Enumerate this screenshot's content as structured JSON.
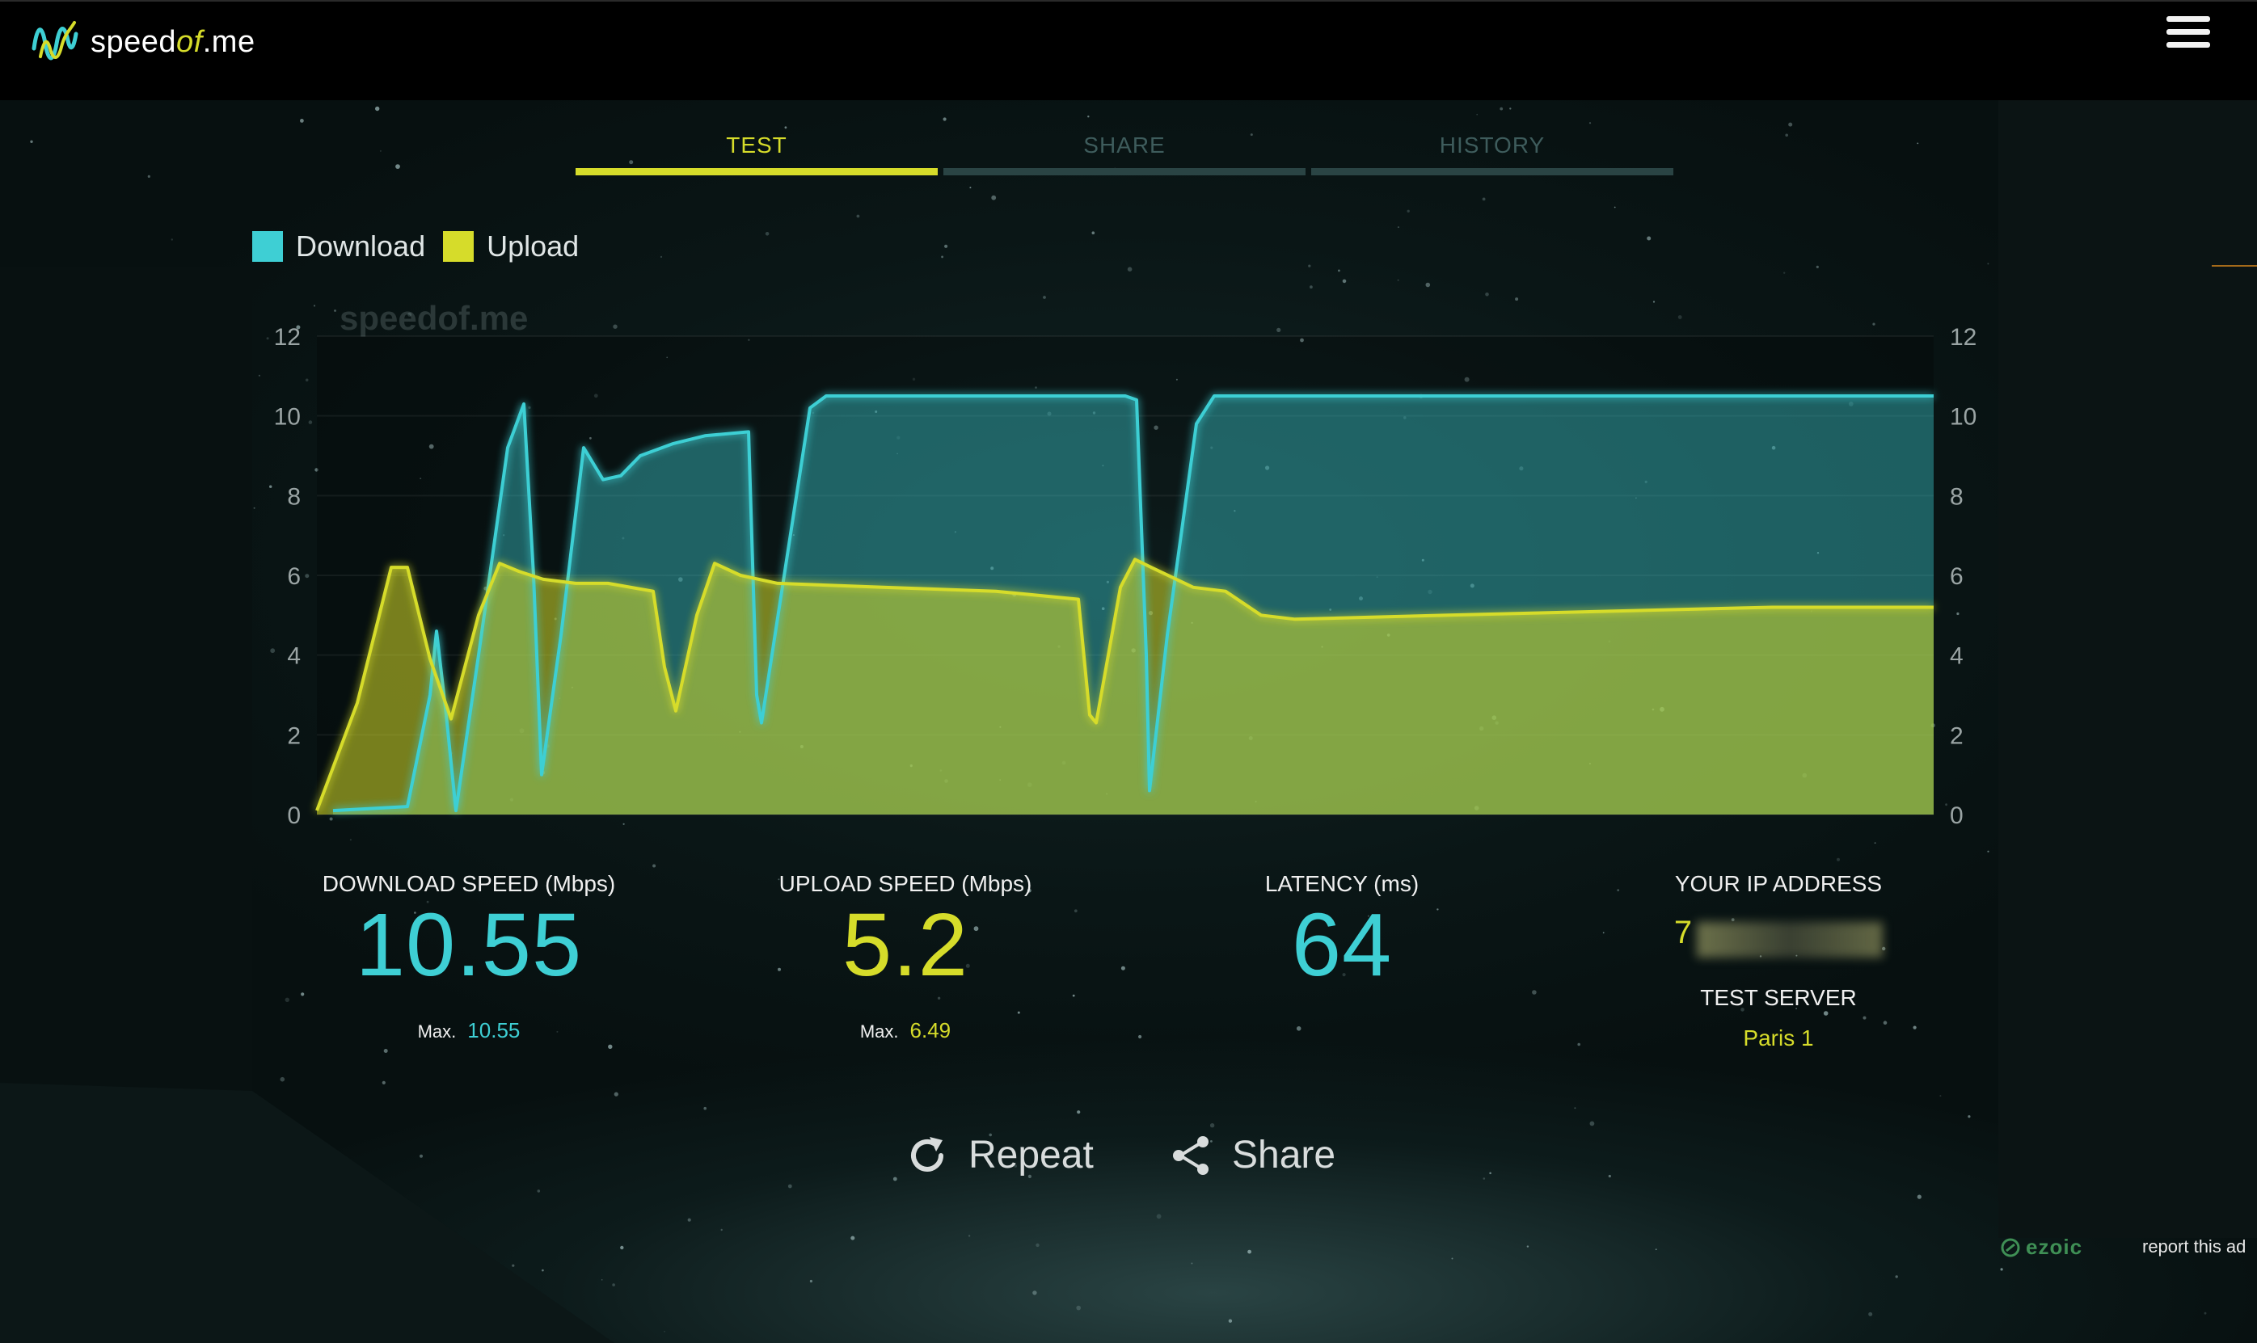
{
  "header": {
    "logo_pre": "speed",
    "logo_mid": "of",
    "logo_post": ".me"
  },
  "tabs": [
    {
      "label": "TEST",
      "active": true
    },
    {
      "label": "SHARE",
      "active": false
    },
    {
      "label": "HISTORY",
      "active": false
    }
  ],
  "colors": {
    "download": "#3ecfd4",
    "upload": "#d6dc2a",
    "header_bg": "#000000"
  },
  "chart_data": {
    "type": "area",
    "watermark": "speedof.me",
    "ylim": [
      0,
      12
    ],
    "yticks": [
      0,
      2,
      4,
      6,
      8,
      10,
      12
    ],
    "xlim": [
      0,
      100
    ],
    "grid": true,
    "legend": "top-left",
    "series": [
      {
        "name": "Download",
        "color": "#3ecfd4",
        "points": [
          [
            1,
            0.1
          ],
          [
            5.6,
            0.2
          ],
          [
            7,
            3
          ],
          [
            7.4,
            4.6
          ],
          [
            8,
            2.5
          ],
          [
            8.6,
            0.1
          ],
          [
            10,
            4
          ],
          [
            11.8,
            9.2
          ],
          [
            12.8,
            10.3
          ],
          [
            13.4,
            6
          ],
          [
            13.9,
            1
          ],
          [
            15.1,
            4.5
          ],
          [
            16.5,
            9.2
          ],
          [
            17.7,
            8.4
          ],
          [
            18.8,
            8.5
          ],
          [
            20,
            9
          ],
          [
            22,
            9.3
          ],
          [
            24,
            9.5
          ],
          [
            26.7,
            9.6
          ],
          [
            27.2,
            3
          ],
          [
            27.5,
            2.3
          ],
          [
            30.5,
            10.2
          ],
          [
            31.5,
            10.5
          ],
          [
            40,
            10.5
          ],
          [
            50,
            10.5
          ],
          [
            50.7,
            10.4
          ],
          [
            51.3,
            4
          ],
          [
            51.5,
            0.6
          ],
          [
            52.6,
            4.5
          ],
          [
            54.4,
            9.8
          ],
          [
            55.5,
            10.5
          ],
          [
            60,
            10.5
          ],
          [
            70,
            10.5
          ],
          [
            80,
            10.5
          ],
          [
            90,
            10.5
          ],
          [
            100,
            10.5
          ]
        ]
      },
      {
        "name": "Upload",
        "color": "#d6dc2a",
        "points": [
          [
            0,
            0.1
          ],
          [
            2.5,
            2.8
          ],
          [
            4.6,
            6.2
          ],
          [
            5.6,
            6.2
          ],
          [
            7,
            3.9
          ],
          [
            8.3,
            2.4
          ],
          [
            10,
            5
          ],
          [
            11.3,
            6.3
          ],
          [
            12.5,
            6.1
          ],
          [
            14,
            5.9
          ],
          [
            16,
            5.8
          ],
          [
            18,
            5.8
          ],
          [
            20.8,
            5.6
          ],
          [
            21.5,
            3.7
          ],
          [
            22.2,
            2.6
          ],
          [
            23.5,
            5
          ],
          [
            24.6,
            6.3
          ],
          [
            26.2,
            6
          ],
          [
            28.5,
            5.8
          ],
          [
            35,
            5.7
          ],
          [
            42,
            5.6
          ],
          [
            47.1,
            5.4
          ],
          [
            47.8,
            2.5
          ],
          [
            48.2,
            2.3
          ],
          [
            49.7,
            5.7
          ],
          [
            50.6,
            6.4
          ],
          [
            51.6,
            6.2
          ],
          [
            54.2,
            5.7
          ],
          [
            56.2,
            5.6
          ],
          [
            58.4,
            5
          ],
          [
            60.5,
            4.9
          ],
          [
            70,
            5
          ],
          [
            80,
            5.1
          ],
          [
            90,
            5.2
          ],
          [
            100,
            5.2
          ]
        ]
      }
    ]
  },
  "stats": {
    "download": {
      "label": "DOWNLOAD SPEED (Mbps)",
      "value": "10.55",
      "max_label": "Max.",
      "max": "10.55"
    },
    "upload": {
      "label": "UPLOAD SPEED (Mbps)",
      "value": "5.2",
      "max_label": "Max.",
      "max": "6.49"
    },
    "latency": {
      "label": "LATENCY (ms)",
      "value": "64"
    },
    "ip": {
      "label": "YOUR IP ADDRESS",
      "value_visible": "7"
    },
    "server": {
      "label": "TEST SERVER",
      "value": "Paris 1"
    }
  },
  "actions": {
    "repeat": "Repeat",
    "share": "Share"
  },
  "ad": {
    "brand": "ezoic",
    "report": "report this ad"
  }
}
